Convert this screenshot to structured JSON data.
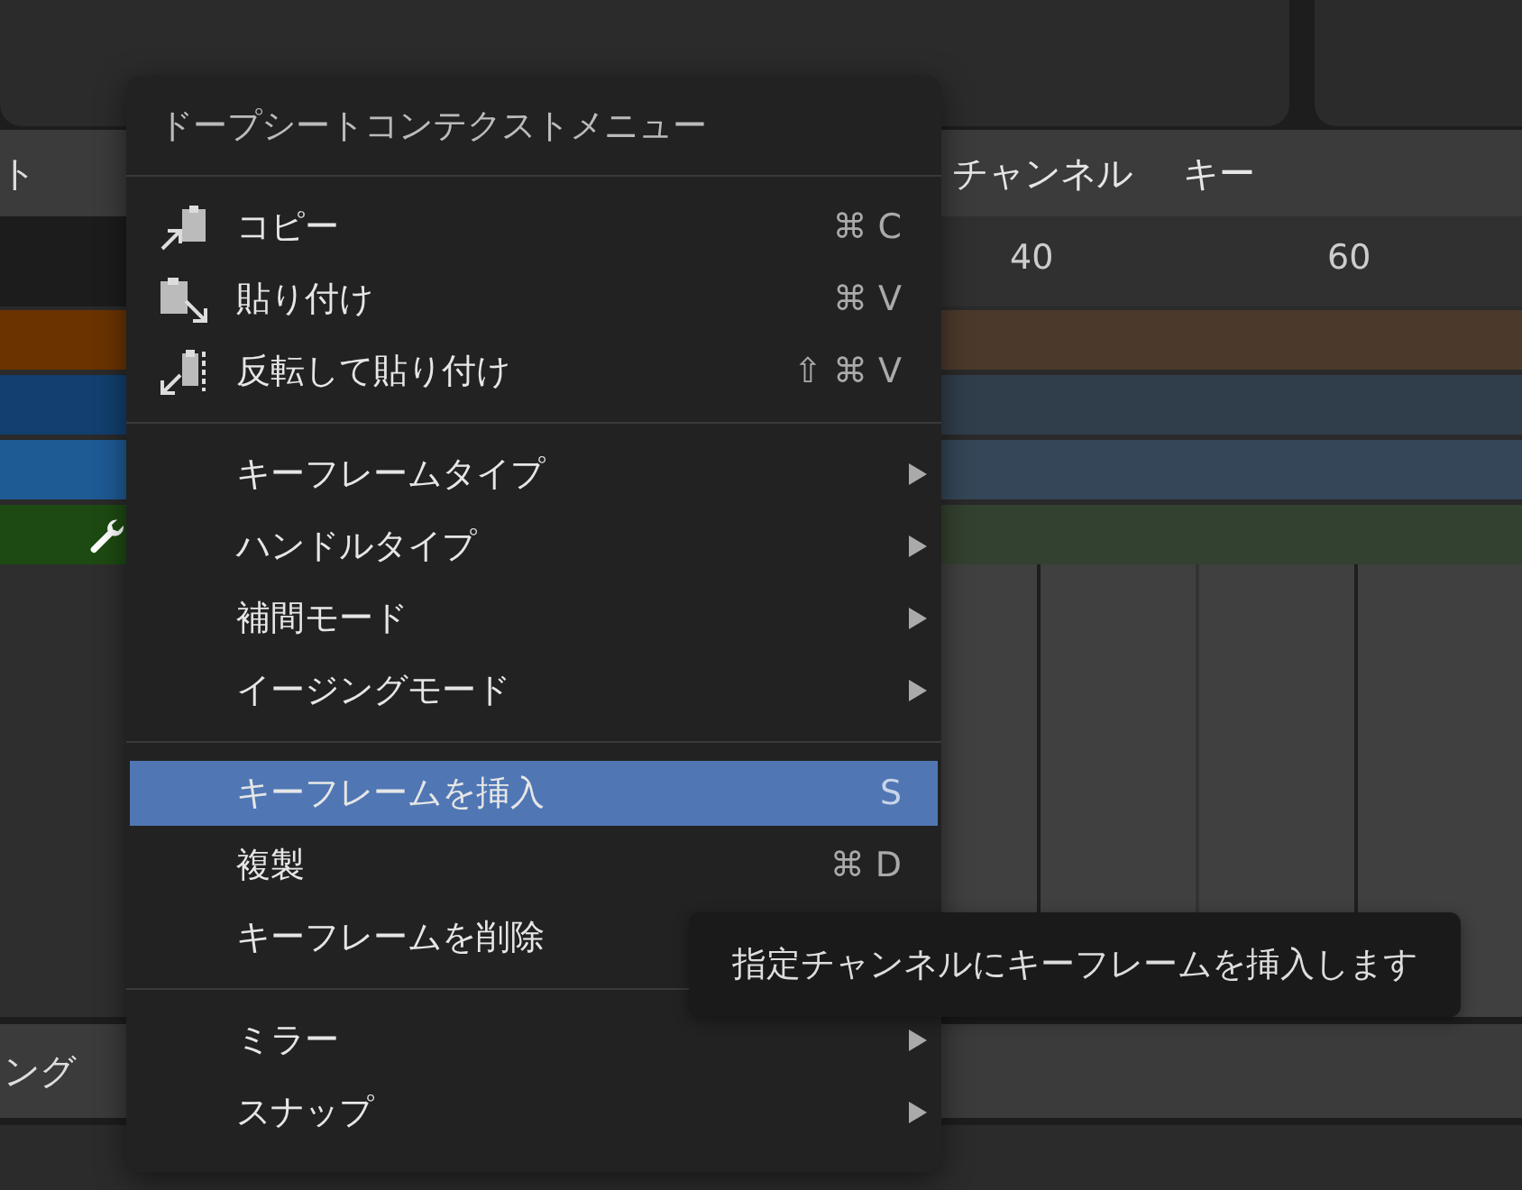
{
  "header": {
    "left_label": "ト",
    "menus": [
      "チャンネル",
      "キー"
    ]
  },
  "ruler": {
    "labels": [
      "40",
      "60"
    ]
  },
  "channels": [
    {
      "color": "#6a3300",
      "kind": "plain"
    },
    {
      "color": "#123f6e",
      "kind": "plain"
    },
    {
      "color": "#1e5a94",
      "kind": "plain"
    },
    {
      "color": "#1d4a12",
      "kind": "modifier"
    }
  ],
  "bottom_header": {
    "label": "ング"
  },
  "context_menu": {
    "title": "ドープシートコンテクストメニュー",
    "sections": [
      [
        {
          "label": "コピー",
          "kind": "copy",
          "shortcut": "⌘ C",
          "selected": false
        },
        {
          "label": "貼り付け",
          "kind": "paste",
          "shortcut": "⌘ V",
          "selected": false
        },
        {
          "label": "反転して貼り付け",
          "kind": "paste-flipped",
          "shortcut": "⇧ ⌘ V",
          "selected": false
        }
      ],
      [
        {
          "label": "キーフレームタイプ",
          "kind": "submenu",
          "selected": false
        },
        {
          "label": "ハンドルタイプ",
          "kind": "submenu",
          "selected": false
        },
        {
          "label": "補間モード",
          "kind": "submenu",
          "selected": false
        },
        {
          "label": "イージングモード",
          "kind": "submenu",
          "selected": false
        }
      ],
      [
        {
          "label": "キーフレームを挿入",
          "kind": "action",
          "shortcut": "S",
          "selected": true
        },
        {
          "label": "複製",
          "kind": "action",
          "shortcut": "⌘ D",
          "selected": false
        },
        {
          "label": "キーフレームを削除",
          "kind": "action",
          "selected": false
        }
      ],
      [
        {
          "label": "ミラー",
          "kind": "submenu",
          "selected": false
        },
        {
          "label": "スナップ",
          "kind": "submenu",
          "selected": false
        }
      ]
    ]
  },
  "tooltip": {
    "text": "指定チャンネルにキーフレームを挿入します"
  }
}
